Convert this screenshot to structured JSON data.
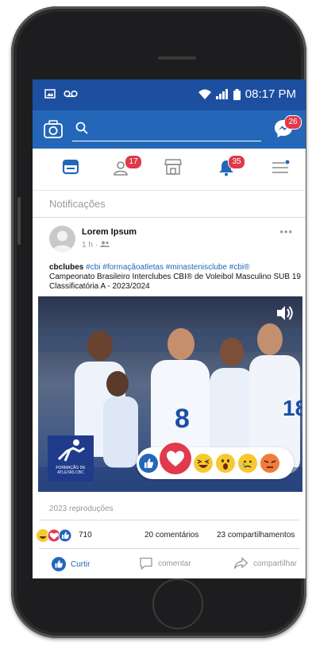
{
  "status_bar": {
    "time": "08:17 PM"
  },
  "appbar": {
    "search_placeholder": "",
    "messenger_badge": "26"
  },
  "tabs": [
    {
      "name": "feed",
      "badge": ""
    },
    {
      "name": "friends",
      "badge": "17"
    },
    {
      "name": "marketplace",
      "badge": ""
    },
    {
      "name": "notifications",
      "badge": "35"
    },
    {
      "name": "menu",
      "badge": ""
    }
  ],
  "section_label": "Notificações",
  "post": {
    "author": "Lorem Ipsum",
    "time": "1 h",
    "handle": "cbclubes",
    "tags": "#cbi #formaçãoatletas #minastenisclube #cbi®",
    "text": "Campeonato Brasileiro Interclubes CBI® de Voleibol Masculino SUB 19 Classificatória A - 2023/2024",
    "logo_text": "FORMAÇÃO DE ATLETAS CBC"
  },
  "views": "2023 reproduções",
  "stats": {
    "reactions_count": "710",
    "comments": "20 comentários",
    "shares": "23 compartilhamentos"
  },
  "actions": {
    "like": "Curtir",
    "comment": "comentar",
    "share": "compartilhar"
  },
  "colors": {
    "statusbar": "#1d4fa1",
    "appbar": "#2467b9",
    "badge": "#e0394a",
    "love": "#e03a4e"
  }
}
